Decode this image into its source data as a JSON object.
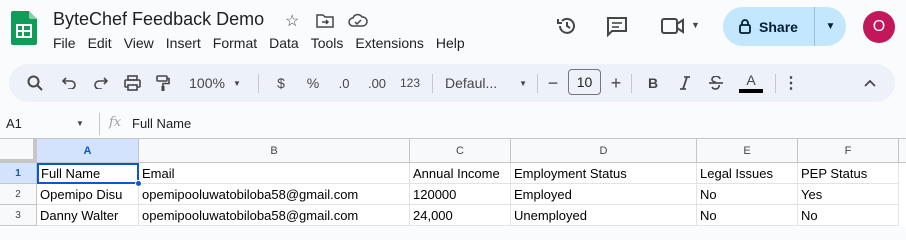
{
  "document": {
    "title": "ByteChef Feedback Demo",
    "star_icon": "star-icon",
    "move_icon": "folder-move-icon",
    "status_icon": "cloud-saved-icon"
  },
  "menu": [
    "File",
    "Edit",
    "View",
    "Insert",
    "Format",
    "Data",
    "Tools",
    "Extensions",
    "Help"
  ],
  "header_actions": {
    "history_icon": "history-icon",
    "comments_icon": "comment-icon",
    "meet_icon": "video-camera-icon",
    "share_label": "Share",
    "avatar_letter": "O",
    "avatar_color": "#c2185b"
  },
  "toolbar": {
    "zoom": "100%",
    "currency": "$",
    "percent": "%",
    "decrease_decimals": ".0",
    "increase_decimals": ".00",
    "more_formats": "123",
    "font": "Defaul...",
    "font_size": "10",
    "bold": "B",
    "text_color": "A"
  },
  "formula_bar": {
    "name_box": "A1",
    "fx": "fx",
    "content": "Full Name"
  },
  "sheet": {
    "columns": [
      "A",
      "B",
      "C",
      "D",
      "E",
      "F"
    ],
    "rows": [
      {
        "num": "1",
        "cells": [
          "Full Name",
          "Email",
          "Annual Income",
          "Employment Status",
          "Legal Issues",
          "PEP Status"
        ]
      },
      {
        "num": "2",
        "cells": [
          "Opemipo Disu",
          "opemipooluwatobiloba58@gmail.com",
          "120000",
          "Employed",
          "No",
          "Yes"
        ]
      },
      {
        "num": "3",
        "cells": [
          "Danny Walter",
          "opemipooluwatobiloba58@gmail.com",
          "24,000",
          "Unemployed",
          "No",
          "No"
        ]
      }
    ],
    "selection_color": "#0b57d0"
  }
}
